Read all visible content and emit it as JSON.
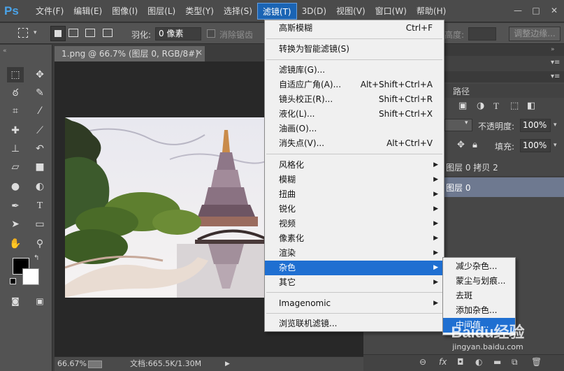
{
  "app": {
    "logo": "Ps"
  },
  "menubar": {
    "items": [
      "文件(F)",
      "编辑(E)",
      "图像(I)",
      "图层(L)",
      "类型(Y)",
      "选择(S)",
      "滤镜(T)",
      "3D(D)",
      "视图(V)",
      "窗口(W)",
      "帮助(H)"
    ],
    "active_index": 6,
    "window_controls": [
      "—",
      "□",
      "✕"
    ]
  },
  "options_bar": {
    "feather_label": "羽化:",
    "feather_value": "0 像素",
    "antialias_label": "消除锯齿",
    "height_label": "高度:",
    "refine_edge_label": "调整边缘..."
  },
  "document": {
    "tab_title": "1.png @ 66.7% (图层 0, RGB/8#) *",
    "tab_close": "×",
    "zoom": "66.67%",
    "doc_info": "文档:665.5K/1.30M"
  },
  "filter_menu": {
    "items": [
      {
        "label": "高斯模糊",
        "shortcut": "Ctrl+F"
      },
      {
        "label": "转换为智能滤镜(S)",
        "shortcut": ""
      },
      {
        "label": "滤镜库(G)...",
        "shortcut": ""
      },
      {
        "label": "自适应广角(A)...",
        "shortcut": "Alt+Shift+Ctrl+A"
      },
      {
        "label": "镜头校正(R)...",
        "shortcut": "Shift+Ctrl+R"
      },
      {
        "label": "液化(L)...",
        "shortcut": "Shift+Ctrl+X"
      },
      {
        "label": "油画(O)...",
        "shortcut": ""
      },
      {
        "label": "消失点(V)...",
        "shortcut": "Alt+Ctrl+V"
      },
      {
        "label": "风格化",
        "submenu": true
      },
      {
        "label": "模糊",
        "submenu": true
      },
      {
        "label": "扭曲",
        "submenu": true
      },
      {
        "label": "锐化",
        "submenu": true
      },
      {
        "label": "视频",
        "submenu": true
      },
      {
        "label": "像素化",
        "submenu": true
      },
      {
        "label": "渲染",
        "submenu": true
      },
      {
        "label": "杂色",
        "submenu": true
      },
      {
        "label": "其它",
        "submenu": true
      },
      {
        "label": "Imagenomic",
        "submenu": true
      },
      {
        "label": "浏览联机滤镜...",
        "shortcut": ""
      }
    ],
    "highlighted": "杂色"
  },
  "noise_submenu": {
    "items": [
      "减少杂色...",
      "蒙尘与划痕...",
      "去斑",
      "添加杂色...",
      "中间值..."
    ],
    "highlighted_index": 4
  },
  "layers_panel": {
    "tab_paths": "路径",
    "opacity_label": "不透明度:",
    "opacity_value": "100%",
    "fill_label": "填充:",
    "fill_value": "100%",
    "layers": [
      {
        "name": "图层 0 拷贝 2",
        "selected": false
      },
      {
        "name": "图层 0",
        "selected": true
      }
    ]
  },
  "watermark": {
    "text": "Baidu经验",
    "url": "jingyan.baidu.com"
  },
  "colors": {
    "accent": "#1f6fd1",
    "menu_bg": "#f0f0f0",
    "app_bg": "#535353"
  }
}
